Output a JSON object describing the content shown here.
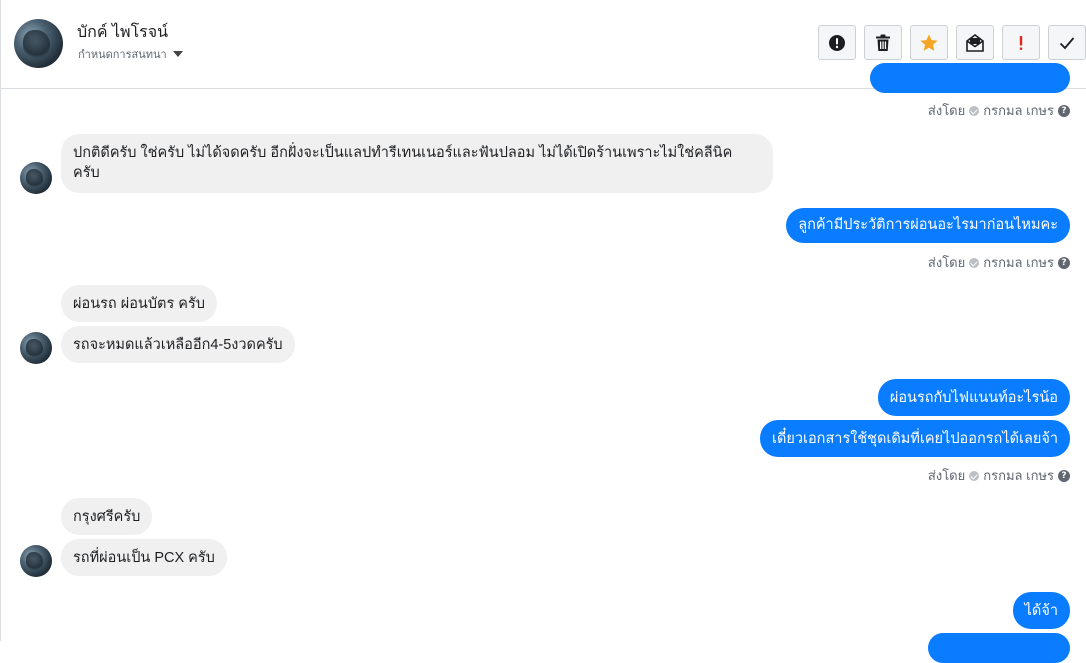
{
  "header": {
    "contact_name": "บักค์ ไพโรจน์",
    "subtitle": "กำหนดการสนทนา",
    "actions": [
      {
        "name": "report-icon"
      },
      {
        "name": "trash-icon"
      },
      {
        "name": "star-icon"
      },
      {
        "name": "mark-unread-icon"
      },
      {
        "name": "important-icon"
      },
      {
        "name": "check-icon"
      }
    ]
  },
  "colors": {
    "outgoing": "#0a7cff",
    "incoming": "#f0f0f0",
    "star": "#f5a623",
    "important": "#e02424"
  },
  "sent_by": {
    "prefix": "ส่งโดย",
    "agent": "กรกมล เกษร"
  },
  "messages": {
    "m1": "ปกติดีครับ ใช่ครับ ไม่ได้จดครับ อีกฝั่งจะเป็นแลปทำรีเทนเนอร์และฟันปลอม ไม่ได้เปิดร้านเพราะไม่ใช่คลีนิค",
    "m1b": "ครับ",
    "m2": "ลูกค้ามีประวัติการผ่อนอะไรมาก่อนไหมคะ",
    "m3": "ผ่อนรถ ผ่อนบัตร ครับ",
    "m4": "รถจะหมดแล้วเหลืออีก4-5งวดครับ",
    "m5": "ผ่อนรถกับไฟแนนท์อะไรน้อ",
    "m6": "เดี๋ยวเอกสารใช้ชุดเดิมที่เคยไปออกรถได้เลยจ้า",
    "m7": "กรุงศรีครับ",
    "m8": "รถที่ผ่อนเป็น PCX ครับ",
    "m9": "ได้จ้า"
  }
}
